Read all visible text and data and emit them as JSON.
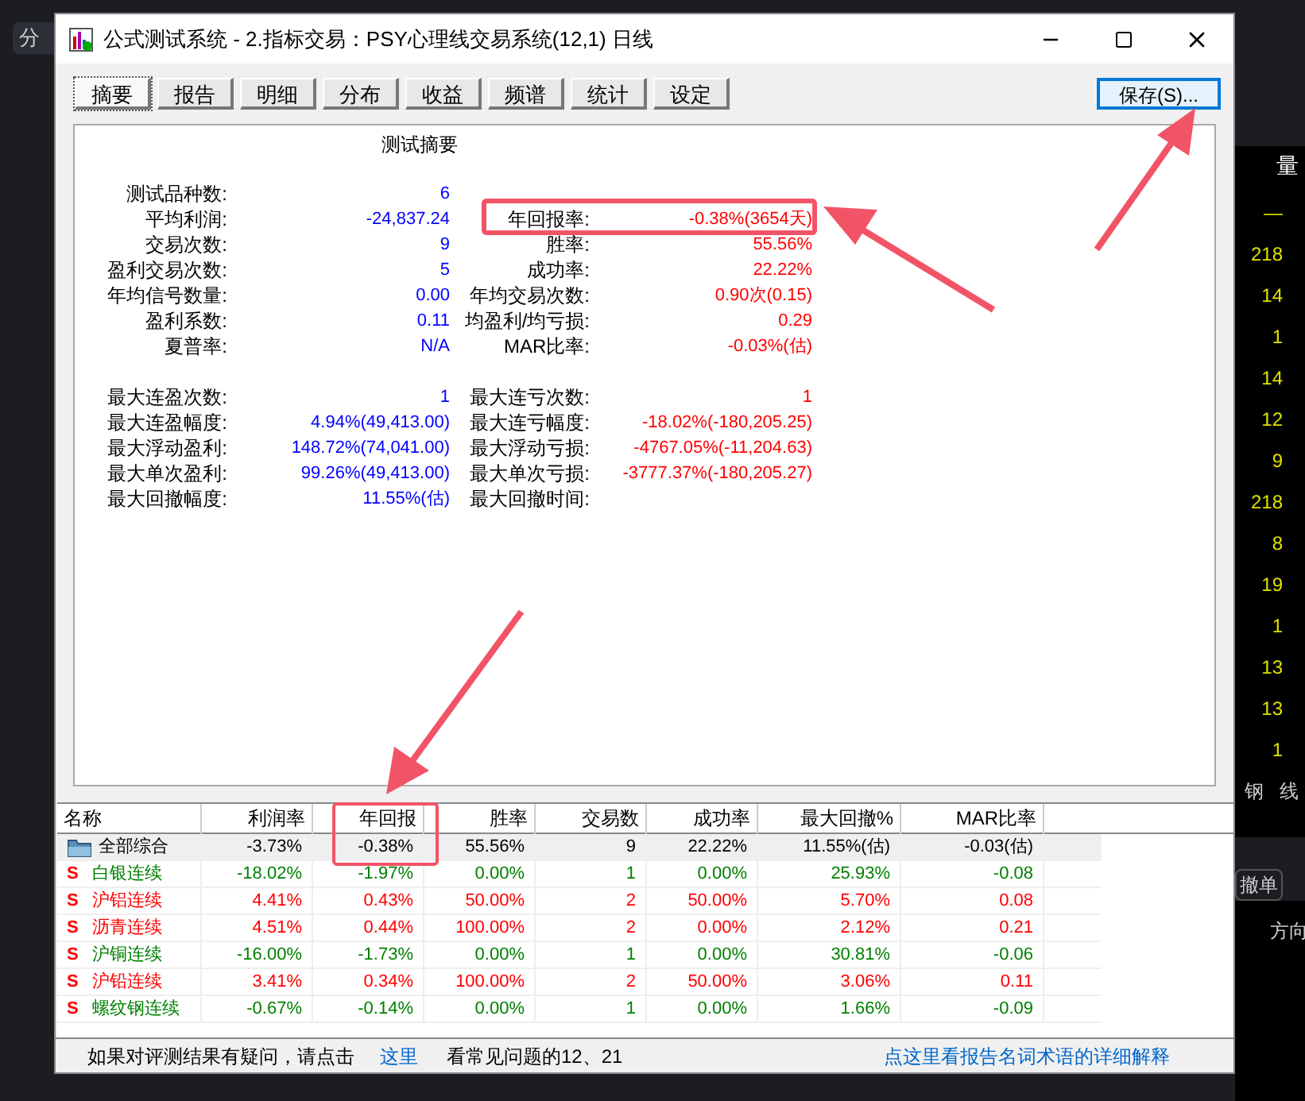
{
  "window": {
    "title": "公式测试系统 - 2.指标交易：PSY心理线交易系统(12,1) 日线"
  },
  "tabs": [
    {
      "label": "摘要",
      "selected": true
    },
    {
      "label": "报告",
      "selected": false
    },
    {
      "label": "明细",
      "selected": false
    },
    {
      "label": "分布",
      "selected": false
    },
    {
      "label": "收益",
      "selected": false
    },
    {
      "label": "频谱",
      "selected": false
    },
    {
      "label": "统计",
      "selected": false
    },
    {
      "label": "设定",
      "selected": false
    }
  ],
  "save_button": "保存(S)...",
  "summary": {
    "title": "测试摘要",
    "sections": [
      [
        {
          "label": "测试品种数:",
          "value": "6"
        },
        {
          "label": "平均利润:",
          "value": "-24,837.24",
          "label2": "年回报率:",
          "value2": "-0.38%(3654天)"
        },
        {
          "label": "交易次数:",
          "value": "9",
          "label2": "胜率:",
          "value2": "55.56%"
        },
        {
          "label": "盈利交易次数:",
          "value": "5",
          "label2": "成功率:",
          "value2": "22.22%"
        },
        {
          "label": "年均信号数量:",
          "value": "0.00",
          "label2": "年均交易次数:",
          "value2": "0.90次(0.15)"
        },
        {
          "label": "盈利系数:",
          "value": "0.11",
          "label2": "均盈利/均亏损:",
          "value2": "0.29"
        },
        {
          "label": "夏普率:",
          "value": "N/A",
          "label2": "MAR比率:",
          "value2": "-0.03%(估)"
        }
      ],
      [
        {
          "label": "最大连盈次数:",
          "value": "1",
          "label2": "最大连亏次数:",
          "value2": "1"
        },
        {
          "label": "最大连盈幅度:",
          "value": "4.94%(49,413.00)",
          "label2": "最大连亏幅度:",
          "value2": "-18.02%(-180,205.25)"
        },
        {
          "label": "最大浮动盈利:",
          "value": "148.72%(74,041.00)",
          "label2": "最大浮动亏损:",
          "value2": "-4767.05%(-11,204.63)"
        },
        {
          "label": "最大单次盈利:",
          "value": "99.26%(49,413.00)",
          "label2": "最大单次亏损:",
          "value2": "-3777.37%(-180,205.27)"
        },
        {
          "label": "最大回撤幅度:",
          "value": "11.55%(估)",
          "label2": "最大回撤时间:"
        }
      ]
    ]
  },
  "table": {
    "columns": [
      "名称",
      "利润率",
      "年回报",
      "胜率",
      "交易数",
      "成功率",
      "最大回撤%",
      "MAR比率"
    ],
    "rows": [
      {
        "kind": "folder",
        "selected": true,
        "color": "#000000",
        "cells": [
          "全部综合",
          "-3.73%",
          "-0.38%",
          "55.56%",
          "9",
          "22.22%",
          "11.55%(估)",
          "-0.03(估)"
        ]
      },
      {
        "kind": "s",
        "icon": "S",
        "selected": false,
        "color": "#008000",
        "cells": [
          "白银连续",
          "-18.02%",
          "-1.97%",
          "0.00%",
          "1",
          "0.00%",
          "25.93%",
          "-0.08"
        ]
      },
      {
        "kind": "s",
        "icon": "S",
        "selected": false,
        "color": "#ff0000",
        "cells": [
          "沪铝连续",
          "4.41%",
          "0.43%",
          "50.00%",
          "2",
          "50.00%",
          "5.70%",
          "0.08"
        ]
      },
      {
        "kind": "s",
        "icon": "S",
        "selected": false,
        "color": "#ff0000",
        "cells": [
          "沥青连续",
          "4.51%",
          "0.44%",
          "100.00%",
          "2",
          "0.00%",
          "2.12%",
          "0.21"
        ]
      },
      {
        "kind": "s",
        "icon": "S",
        "selected": false,
        "color": "#008000",
        "cells": [
          "沪铜连续",
          "-16.00%",
          "-1.73%",
          "0.00%",
          "1",
          "0.00%",
          "30.81%",
          "-0.06"
        ]
      },
      {
        "kind": "s",
        "icon": "S",
        "selected": false,
        "color": "#ff0000",
        "cells": [
          "沪铅连续",
          "3.41%",
          "0.34%",
          "100.00%",
          "2",
          "50.00%",
          "3.06%",
          "0.11"
        ]
      },
      {
        "kind": "s",
        "icon": "S",
        "selected": false,
        "color": "#008000",
        "cells": [
          "螺纹钢连续",
          "-0.67%",
          "-0.14%",
          "0.00%",
          "1",
          "0.00%",
          "1.66%",
          "-0.09"
        ]
      }
    ]
  },
  "footer": {
    "question": "如果对评测结果有疑问，请点击",
    "link": "这里",
    "faq": "看常见问题的12、21",
    "glossary_link": "点这里看报告名词术语的详细解释"
  },
  "background": {
    "top_tab": "分",
    "volume_header": "量",
    "volume_values": [
      "—",
      "218",
      "14",
      "1",
      "14",
      "12",
      "9",
      "218",
      "8",
      "19",
      "1",
      "13",
      "13",
      "1"
    ],
    "labels": [
      "钢",
      "线"
    ],
    "cancel_button": "撤单",
    "direction_header": "方向"
  }
}
